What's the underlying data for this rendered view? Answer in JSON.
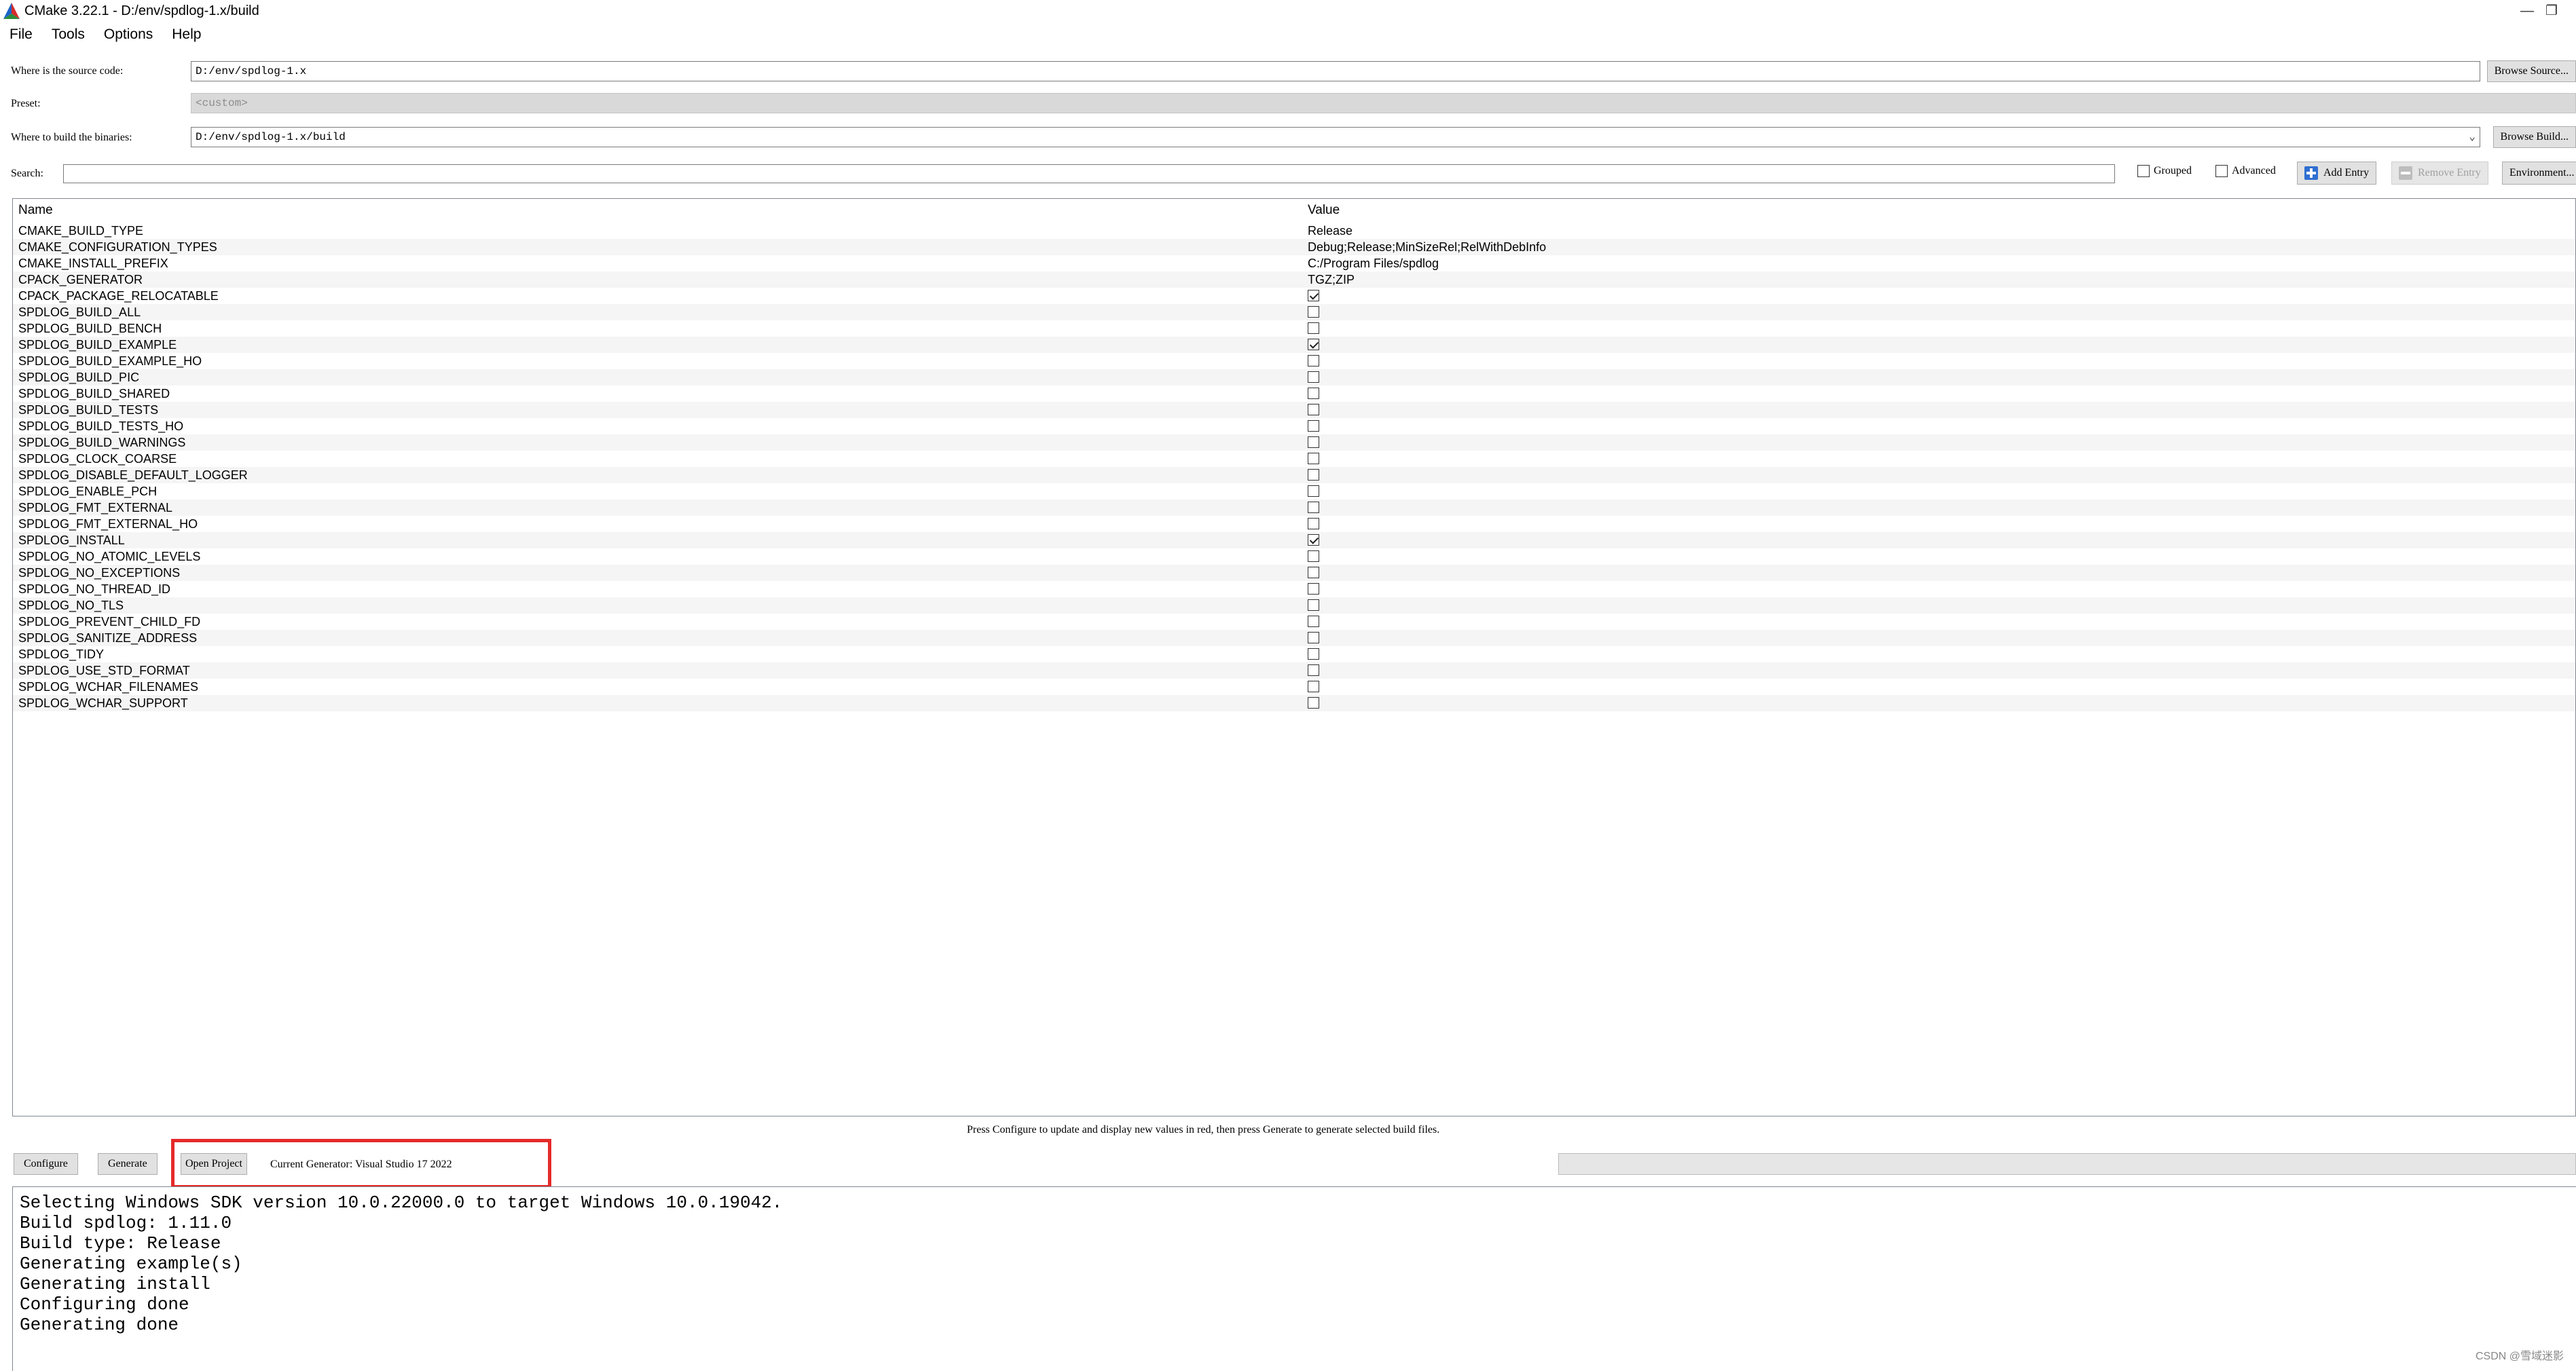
{
  "window": {
    "title": "CMake 3.22.1 - D:/env/spdlog-1.x/build",
    "minimize_glyph": "—",
    "restore_glyph": "❐"
  },
  "menu": [
    "File",
    "Tools",
    "Options",
    "Help"
  ],
  "source": {
    "label": "Where is the source code:",
    "value": "D:/env/spdlog-1.x",
    "browse_label": "Browse Source..."
  },
  "preset": {
    "label": "Preset:",
    "value": "<custom>"
  },
  "build": {
    "label": "Where to build the binaries:",
    "value": "D:/env/spdlog-1.x/build",
    "browse_label": "Browse Build..."
  },
  "search": {
    "label": "Search:",
    "value": "",
    "grouped_label": "Grouped",
    "grouped_checked": false,
    "advanced_label": "Advanced",
    "advanced_checked": false,
    "add_entry_label": "Add Entry",
    "remove_entry_label": "Remove Entry",
    "environment_label": "Environment..."
  },
  "cache": {
    "name_header": "Name",
    "value_header": "Value",
    "rows": [
      {
        "name": "CMAKE_BUILD_TYPE",
        "type": "text",
        "value": "Release"
      },
      {
        "name": "CMAKE_CONFIGURATION_TYPES",
        "type": "text",
        "value": "Debug;Release;MinSizeRel;RelWithDebInfo"
      },
      {
        "name": "CMAKE_INSTALL_PREFIX",
        "type": "text",
        "value": "C:/Program Files/spdlog"
      },
      {
        "name": "CPACK_GENERATOR",
        "type": "text",
        "value": "TGZ;ZIP"
      },
      {
        "name": "CPACK_PACKAGE_RELOCATABLE",
        "type": "bool",
        "checked": true
      },
      {
        "name": "SPDLOG_BUILD_ALL",
        "type": "bool",
        "checked": false
      },
      {
        "name": "SPDLOG_BUILD_BENCH",
        "type": "bool",
        "checked": false
      },
      {
        "name": "SPDLOG_BUILD_EXAMPLE",
        "type": "bool",
        "checked": true
      },
      {
        "name": "SPDLOG_BUILD_EXAMPLE_HO",
        "type": "bool",
        "checked": false
      },
      {
        "name": "SPDLOG_BUILD_PIC",
        "type": "bool",
        "checked": false
      },
      {
        "name": "SPDLOG_BUILD_SHARED",
        "type": "bool",
        "checked": false
      },
      {
        "name": "SPDLOG_BUILD_TESTS",
        "type": "bool",
        "checked": false
      },
      {
        "name": "SPDLOG_BUILD_TESTS_HO",
        "type": "bool",
        "checked": false
      },
      {
        "name": "SPDLOG_BUILD_WARNINGS",
        "type": "bool",
        "checked": false
      },
      {
        "name": "SPDLOG_CLOCK_COARSE",
        "type": "bool",
        "checked": false
      },
      {
        "name": "SPDLOG_DISABLE_DEFAULT_LOGGER",
        "type": "bool",
        "checked": false
      },
      {
        "name": "SPDLOG_ENABLE_PCH",
        "type": "bool",
        "checked": false
      },
      {
        "name": "SPDLOG_FMT_EXTERNAL",
        "type": "bool",
        "checked": false
      },
      {
        "name": "SPDLOG_FMT_EXTERNAL_HO",
        "type": "bool",
        "checked": false
      },
      {
        "name": "SPDLOG_INSTALL",
        "type": "bool",
        "checked": true
      },
      {
        "name": "SPDLOG_NO_ATOMIC_LEVELS",
        "type": "bool",
        "checked": false
      },
      {
        "name": "SPDLOG_NO_EXCEPTIONS",
        "type": "bool",
        "checked": false
      },
      {
        "name": "SPDLOG_NO_THREAD_ID",
        "type": "bool",
        "checked": false
      },
      {
        "name": "SPDLOG_NO_TLS",
        "type": "bool",
        "checked": false
      },
      {
        "name": "SPDLOG_PREVENT_CHILD_FD",
        "type": "bool",
        "checked": false
      },
      {
        "name": "SPDLOG_SANITIZE_ADDRESS",
        "type": "bool",
        "checked": false
      },
      {
        "name": "SPDLOG_TIDY",
        "type": "bool",
        "checked": false
      },
      {
        "name": "SPDLOG_USE_STD_FORMAT",
        "type": "bool",
        "checked": false
      },
      {
        "name": "SPDLOG_WCHAR_FILENAMES",
        "type": "bool",
        "checked": false
      },
      {
        "name": "SPDLOG_WCHAR_SUPPORT",
        "type": "bool",
        "checked": false
      }
    ]
  },
  "hint": "Press Configure to update and display new values in red, then press Generate to generate selected build files.",
  "actions": {
    "configure_label": "Configure",
    "generate_label": "Generate",
    "open_project_label": "Open Project",
    "current_generator": "Current Generator: Visual Studio 17 2022"
  },
  "output": [
    "Selecting Windows SDK version 10.0.22000.0 to target Windows 10.0.19042.",
    "Build spdlog: 1.11.0",
    "Build type: Release",
    "Generating example(s)",
    "Generating install",
    "Configuring done",
    "Generating done"
  ],
  "watermark": "CSDN @雪域迷影",
  "colors": {
    "highlight_box": "#e52a2a",
    "button_face": "#e1e1e1",
    "logo_red": "#d62b2b",
    "logo_green": "#2c8c3c",
    "logo_blue": "#1c63c8"
  }
}
